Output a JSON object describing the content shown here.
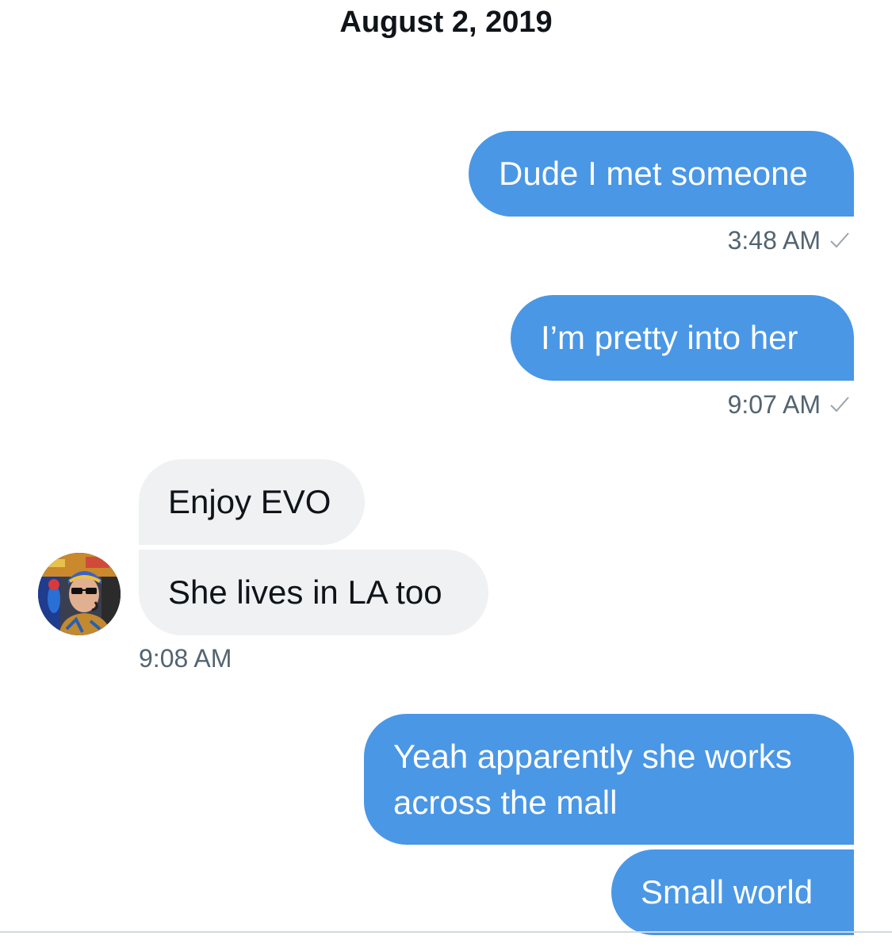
{
  "conversation": {
    "date": "August 2, 2019",
    "messages": [
      {
        "text": "Dude I met someone",
        "direction": "sent",
        "time": "3:48 AM"
      },
      {
        "text": "I’m pretty into her",
        "direction": "sent",
        "time": "9:07 AM"
      },
      {
        "text": "Enjoy EVO",
        "direction": "received"
      },
      {
        "text": "She lives in LA too",
        "direction": "received",
        "time": "9:08 AM"
      },
      {
        "text": "Yeah apparently she works across the mall",
        "direction": "sent"
      },
      {
        "text": "Small world",
        "direction": "sent"
      }
    ]
  },
  "icons": {
    "read_receipt": "check-icon",
    "contact_avatar": "avatar"
  },
  "colors": {
    "sent_bubble": "#4a97e6",
    "received_bubble": "#eff1f3",
    "timestamp": "#536471"
  }
}
